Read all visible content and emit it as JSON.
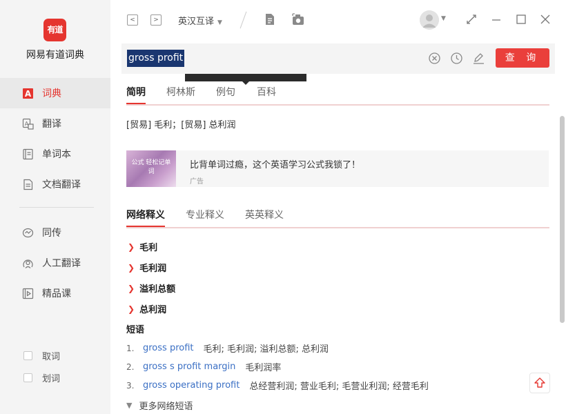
{
  "app": {
    "logo_text": "有道",
    "brand": "网易有道词典"
  },
  "sidebar": {
    "items": [
      {
        "label": "词典",
        "icon": "dictionary-icon",
        "active": true
      },
      {
        "label": "翻译",
        "icon": "translate-icon",
        "active": false
      },
      {
        "label": "单词本",
        "icon": "wordbook-icon",
        "active": false
      },
      {
        "label": "文档翻译",
        "icon": "document-translate-icon",
        "active": false
      },
      {
        "label": "同传",
        "icon": "simultaneous-interpretation-icon",
        "active": false
      },
      {
        "label": "人工翻译",
        "icon": "human-translation-icon",
        "active": false
      },
      {
        "label": "精品课",
        "icon": "course-icon",
        "active": false
      }
    ],
    "checkboxes": [
      {
        "label": "取词",
        "checked": false
      },
      {
        "label": "划词",
        "checked": false
      }
    ]
  },
  "toolbar": {
    "back": "<",
    "forward": ">",
    "language_mode": "英汉互译"
  },
  "search": {
    "query": "gross profit",
    "button_label": "查 询"
  },
  "result": {
    "tabs": [
      "简明",
      "柯林斯",
      "例句",
      "百科"
    ],
    "active_tab": "简明",
    "definition": "[贸易] 毛利；[贸易] 总利润"
  },
  "ad": {
    "image_text": "公式 轻松记单词",
    "title": "比背单词过瘾，这个英语学习公式我锁了！",
    "label": "广告"
  },
  "web": {
    "tabs": [
      "网络释义",
      "专业释义",
      "英英释义"
    ],
    "active_tab": "网络释义",
    "meanings": [
      "毛利",
      "毛利润",
      "溢利总额",
      "总利润"
    ],
    "phrases_title": "短语",
    "phrases": [
      {
        "num": "1.",
        "en": "gross profit",
        "zh": "毛利;  毛利润;  溢利总额;  总利润"
      },
      {
        "num": "2.",
        "en": "gross s profit margin",
        "zh": "毛利润率"
      },
      {
        "num": "3.",
        "en": "gross operating profit",
        "zh": "总经营利润;  营业毛利;  毛营业利润;  经营毛利"
      }
    ],
    "more_label": "更多网络短语"
  },
  "colors": {
    "accent": "#e5352f",
    "link": "#3a6fc4",
    "selection": "#1a3670"
  }
}
